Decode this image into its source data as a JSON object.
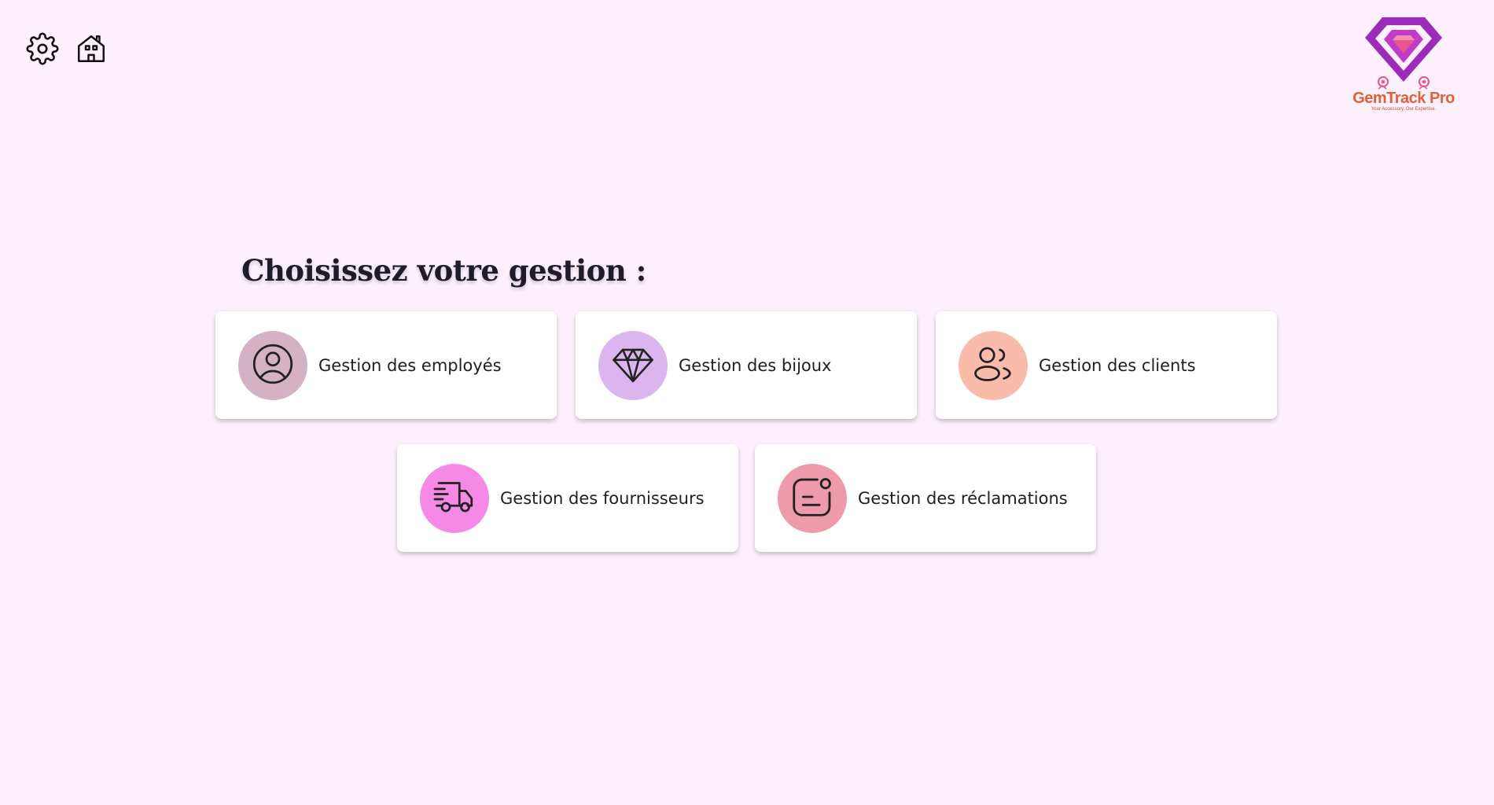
{
  "toolbar": {
    "settings_icon": "gear-icon",
    "home_icon": "home-icon"
  },
  "brand": {
    "name": "GemTrack Pro",
    "tagline": "Your Accessory, Our Expertise.",
    "colors": {
      "primary": "#9b2bb8",
      "accent": "#e0603a",
      "gem": "#e85590"
    }
  },
  "page": {
    "title": "Choisissez votre gestion :"
  },
  "cards": [
    {
      "label": "Gestion des employés",
      "icon": "user-icon",
      "color": "#d4b2c4"
    },
    {
      "label": "Gestion des bijoux",
      "icon": "diamond-icon",
      "color": "#dcb4ee"
    },
    {
      "label": "Gestion des clients",
      "icon": "users-icon",
      "color": "#f9bcaa"
    },
    {
      "label": "Gestion des fournisseurs",
      "icon": "truck-icon",
      "color": "#f58ae6"
    },
    {
      "label": "Gestion des réclamations",
      "icon": "message-icon",
      "color": "#ef9aac"
    }
  ],
  "background": "#fcf0fc"
}
